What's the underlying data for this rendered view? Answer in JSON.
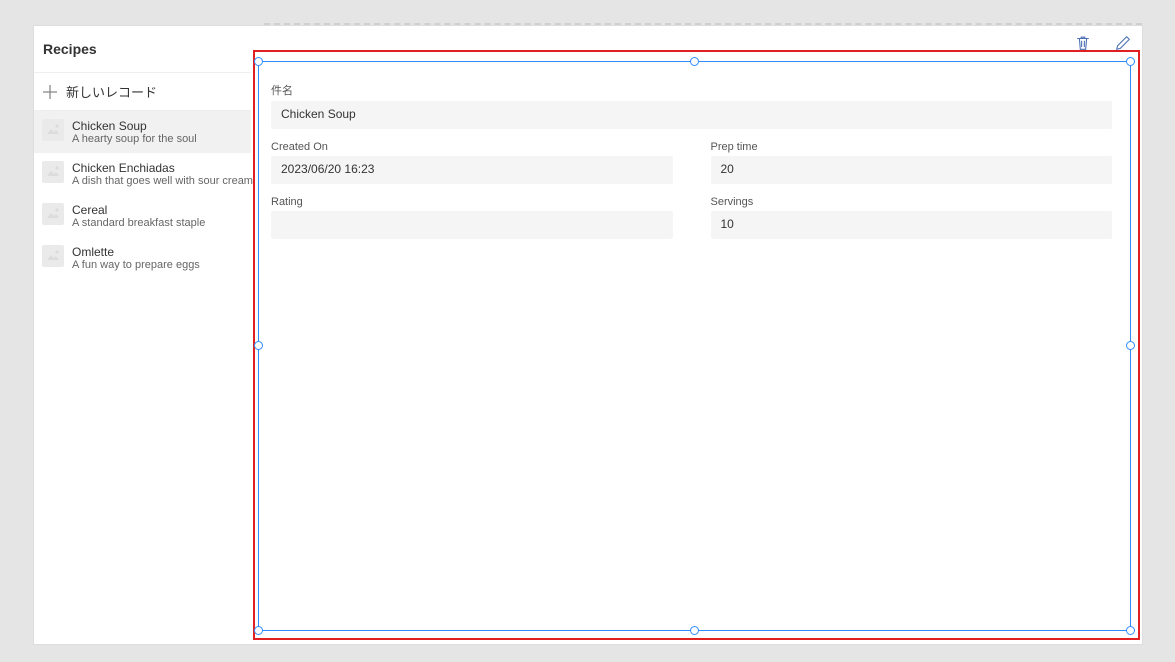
{
  "sidebar": {
    "title": "Recipes",
    "new_record_label": "新しいレコード",
    "items": [
      {
        "title": "Chicken Soup",
        "subtitle": "A hearty soup for the soul",
        "selected": true
      },
      {
        "title": "Chicken Enchiadas",
        "subtitle": "A dish that goes well with sour cream",
        "selected": false
      },
      {
        "title": "Cereal",
        "subtitle": "A standard breakfast staple",
        "selected": false
      },
      {
        "title": "Omlette",
        "subtitle": "A fun way to prepare eggs",
        "selected": false
      }
    ]
  },
  "detail": {
    "fields": {
      "subject": {
        "label": "件名",
        "value": "Chicken Soup"
      },
      "created_on": {
        "label": "Created On",
        "value": "2023/06/20 16:23"
      },
      "prep_time": {
        "label": "Prep time",
        "value": "20"
      },
      "rating": {
        "label": "Rating",
        "value": ""
      },
      "servings": {
        "label": "Servings",
        "value": "10"
      }
    }
  },
  "icons": {
    "delete": "trash-icon",
    "edit": "pencil-icon",
    "add": "plus-icon",
    "thumbnail": "image-placeholder-icon"
  }
}
